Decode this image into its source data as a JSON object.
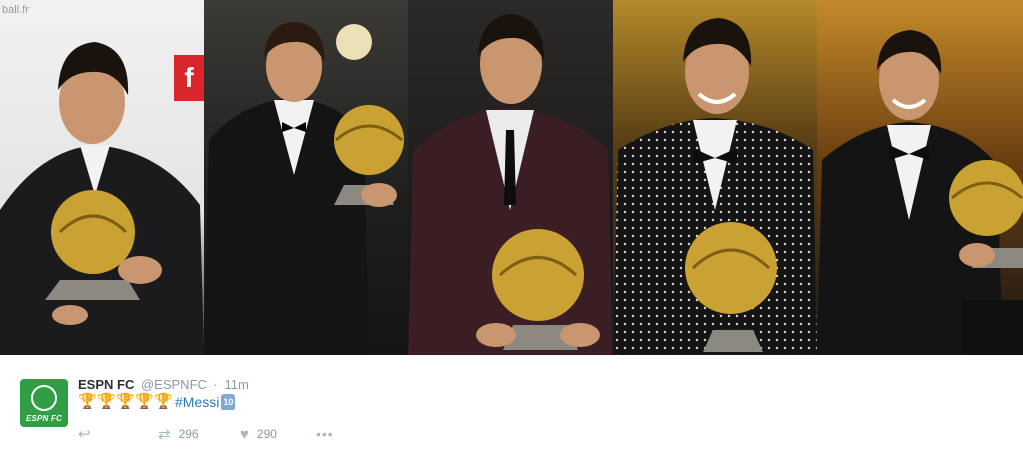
{
  "photos": [
    {
      "bg_text": "ball.fr",
      "logo": "f"
    },
    {},
    {},
    {},
    {}
  ],
  "tweet": {
    "name": "ESPN FC",
    "handle": "@ESPNFC",
    "separator": "·",
    "time": "11m",
    "avatar_text": "ESPN FC",
    "trophies": [
      "🏆",
      "🏆",
      "🏆",
      "🏆",
      "🏆"
    ],
    "hashtag": "#Messi",
    "jersey_number": "10",
    "retweets": "296",
    "likes": "290",
    "more_label": "•••"
  },
  "colors": {
    "avatar_bg": "#2f9e44",
    "hashtag": "#2b7bb9",
    "meta": "#8899a6",
    "trophy": "#e3a21a"
  }
}
